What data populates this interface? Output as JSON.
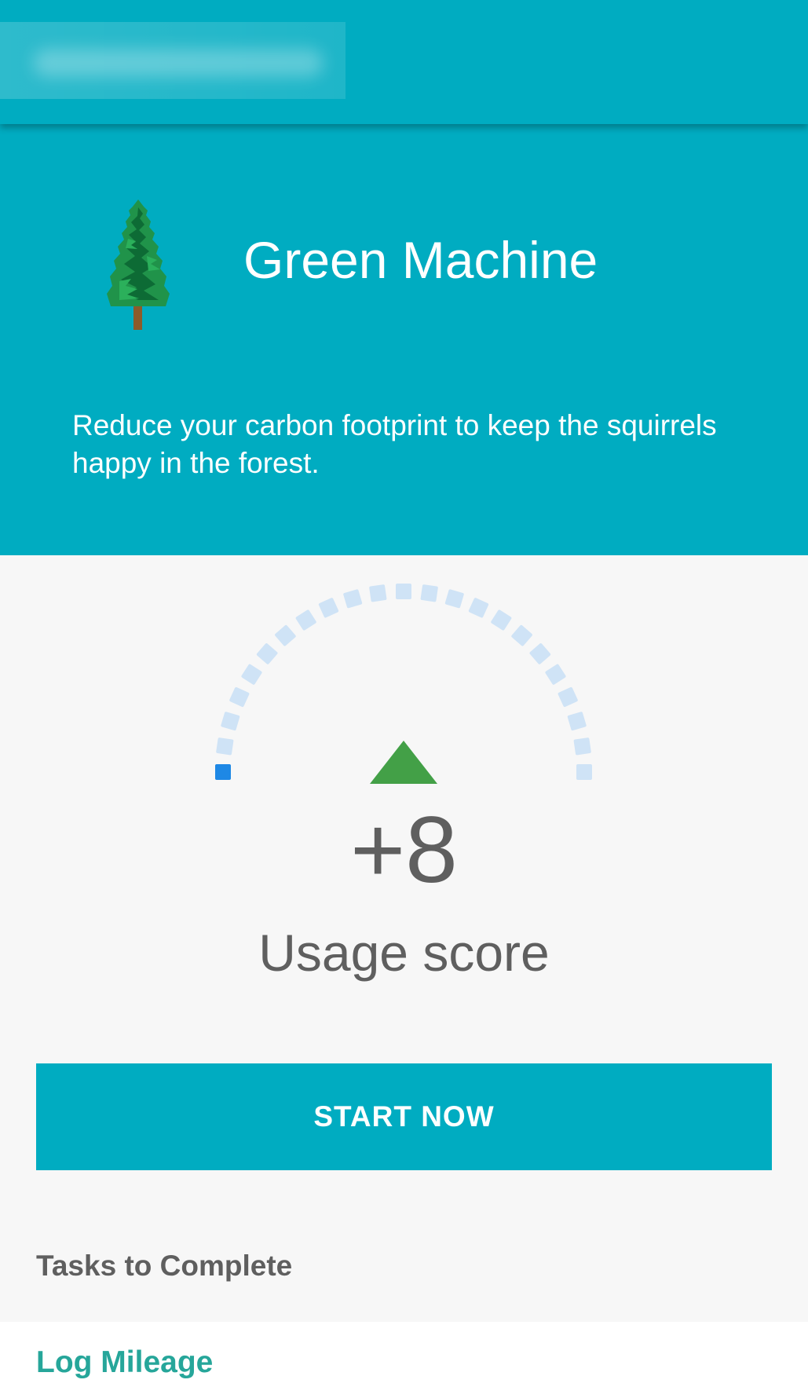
{
  "app": {
    "header_background": "#00acc1",
    "title_blurred": true
  },
  "hero": {
    "icon": "pine-tree-icon",
    "title": "Green Machine",
    "description": "Reduce your carbon footprint to keep the squirrels happy in the forest."
  },
  "score": {
    "value": "+8",
    "label": "Usage score",
    "trend": "up",
    "gauge_level": 0.05,
    "gauge_active_color": "#1e88e5",
    "gauge_inactive_color": "#cfe3f6",
    "trend_color": "#43a047"
  },
  "actions": {
    "start_label": "START NOW"
  },
  "tasks": {
    "header": "Tasks to Complete",
    "items": [
      {
        "label": "Log Mileage"
      }
    ]
  }
}
